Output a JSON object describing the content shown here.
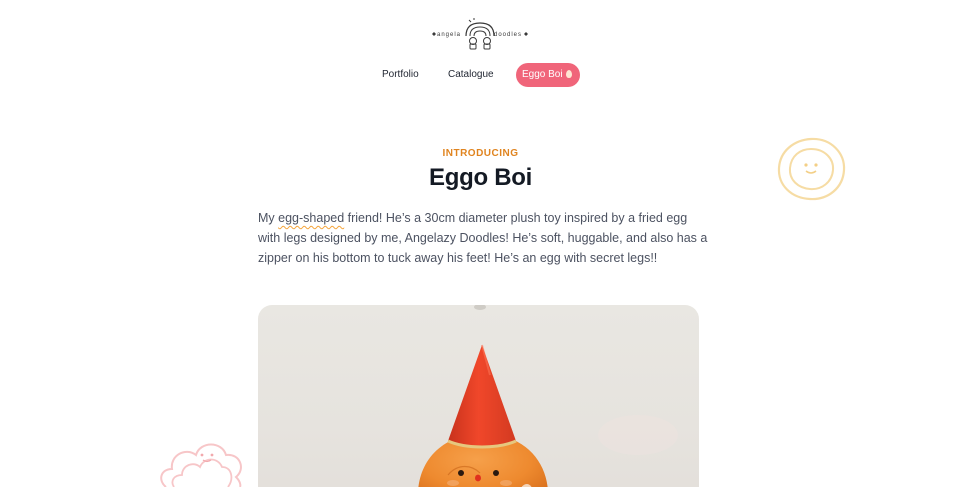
{
  "brand": {
    "logo_text": "angelazy doodles"
  },
  "nav": {
    "items": [
      {
        "label": "Portfolio"
      },
      {
        "label": "Catalogue"
      },
      {
        "label": "Eggo Boi",
        "active": true,
        "icon": "egg-icon"
      }
    ]
  },
  "hero": {
    "eyebrow": "INTRODUCING",
    "title": "Eggo Boi"
  },
  "intro": {
    "before": "My ",
    "highlight": "egg-shaped",
    "after": " friend! He’s a 30cm diameter plush toy inspired by a fried egg with legs designed by me, Angelazy Doodles! He’s soft, huggable, and also has a zipper on his bottom to tuck away his feet! He’s an egg with secret legs!!"
  },
  "decorations": [
    "smiling-sun-icon",
    "smiling-cloud-icon"
  ],
  "colors": {
    "accent_pink": "#f0657a",
    "eyebrow_orange": "#e0841f",
    "title": "#141a24",
    "body_text": "#4c5261",
    "sun_doodle": "#f6dca4",
    "cloud_doodle": "#f7c6c8"
  }
}
